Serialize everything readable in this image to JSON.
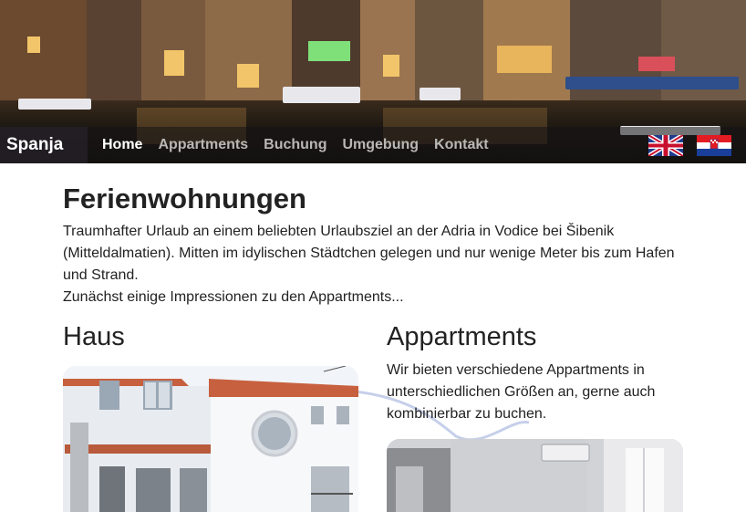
{
  "header": {
    "brand": "Spanja",
    "nav": [
      {
        "label": "Home",
        "active": true
      },
      {
        "label": "Appartments",
        "active": false
      },
      {
        "label": "Buchung",
        "active": false
      },
      {
        "label": "Umgebung",
        "active": false
      },
      {
        "label": "Kontakt",
        "active": false
      }
    ],
    "flags": [
      "uk-flag-icon",
      "croatia-flag-icon"
    ]
  },
  "main": {
    "title": "Ferienwohnungen",
    "intro": [
      "Traumhafter Urlaub an einem beliebten Urlaubsziel an der Adria in Vodice bei Šibenik (Mitteldalmatien). Mitten im idylischen Städtchen gelegen und nur wenige Meter bis zum Hafen und Strand.",
      "Zunächst einige Impressionen zu den Appartments..."
    ],
    "left": {
      "heading": "Haus"
    },
    "right": {
      "heading": "Appartments",
      "text": "Wir bieten verschiedene Appartments in unterschiedlichen Größen an, gerne auch kombinierbar zu buchen."
    }
  },
  "colors": {
    "nav_active": "#ffffff",
    "nav_inactive": "#b9b7b4",
    "text": "#222222"
  }
}
